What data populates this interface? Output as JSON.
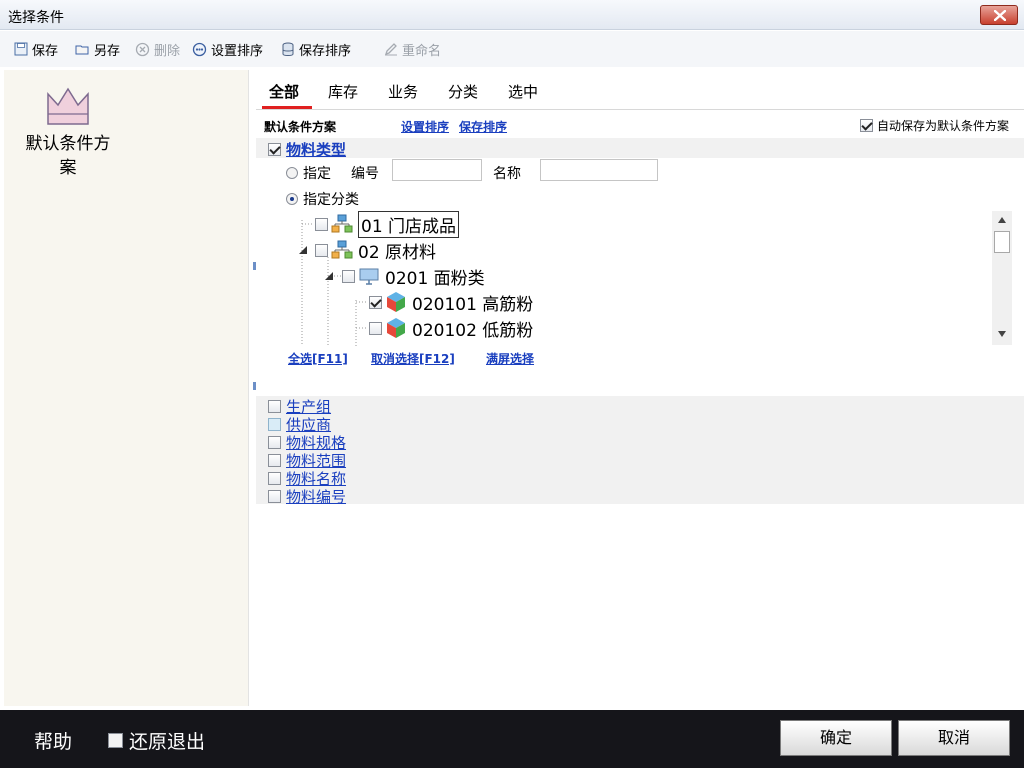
{
  "window": {
    "title": "选择条件"
  },
  "toolbar": {
    "save": "保存",
    "save_as": "另存",
    "delete": "删除",
    "set_sort": "设置排序",
    "save_sort": "保存排序",
    "rename": "重命名"
  },
  "left": {
    "scheme_label": "默认条件方案"
  },
  "tabs": [
    {
      "label": "全部",
      "active": true
    },
    {
      "label": "库存"
    },
    {
      "label": "业务"
    },
    {
      "label": "分类"
    },
    {
      "label": "选中"
    }
  ],
  "header": {
    "scheme_name": "默认条件方案",
    "set_sort_link": "设置排序",
    "save_sort_link": "保存排序",
    "auto_save_label": "自动保存为默认条件方案",
    "auto_save_checked": true
  },
  "material_type": {
    "title": "物料类型",
    "checked": true,
    "option_specify": "指定",
    "code_label": "编号",
    "code_value": "",
    "name_label": "名称",
    "name_value": "",
    "option_category": "指定分类",
    "selected_option": "指定分类"
  },
  "tree": [
    {
      "label": "01 门店成品",
      "checked": false,
      "focused": true
    },
    {
      "label": "02 原材料",
      "checked": false,
      "expanded": true
    },
    {
      "label": "0201 面粉类",
      "checked": false,
      "expanded": true
    },
    {
      "label": "020101 高筋粉",
      "checked": true
    },
    {
      "label": "020102 低筋粉",
      "checked": false
    }
  ],
  "tree_actions": {
    "select_all": "全选[F11]",
    "deselect": "取消选择[F12]",
    "fullscreen": "满屏选择"
  },
  "filters": [
    {
      "label": "生产组",
      "checked": false
    },
    {
      "label": "供应商",
      "checked": false,
      "highlight": true
    },
    {
      "label": "物料规格",
      "checked": false
    },
    {
      "label": "物料范围",
      "checked": false
    },
    {
      "label": "物料名称",
      "checked": false
    },
    {
      "label": "物料编号",
      "checked": false
    }
  ],
  "footer": {
    "help": "帮助",
    "restore_exit": "还原退出",
    "ok": "确定",
    "cancel": "取消"
  },
  "colors": {
    "accent_red": "#e02020",
    "link_blue": "#1a3fbf",
    "footer_bg": "#15151a",
    "left_panel_bg": "#f8f6ef"
  }
}
